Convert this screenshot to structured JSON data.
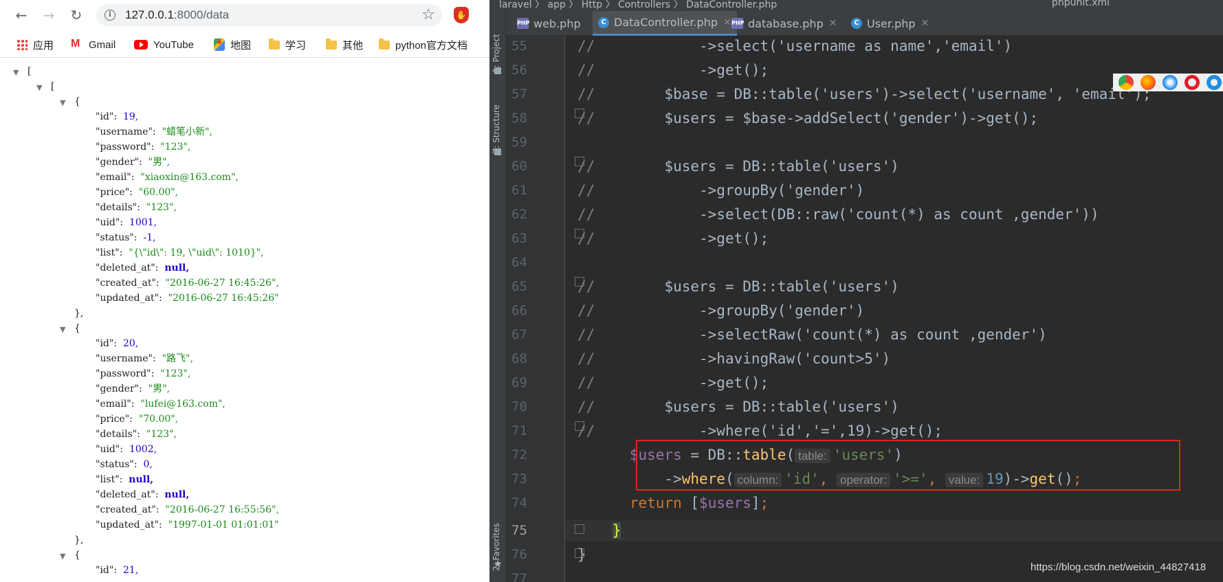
{
  "browser": {
    "url_host": "127.0.0.1",
    "url_rest": ":8000/data",
    "bookmarks": [
      "应用",
      "Gmail",
      "YouTube",
      "地图",
      "学习",
      "其他",
      "python官方文档"
    ]
  },
  "json_lines": [
    "[",
    "[",
    "{",
    "\"id\":",
    "19,",
    "\"username\":",
    "\"蜡笔小新\",",
    "\"password\":",
    "\"123\",",
    "\"gender\":",
    "\"男\",",
    "\"email\":",
    "\"xiaoxin@163.com\",",
    "\"price\":",
    "\"60.00\",",
    "\"details\":",
    "\"123\",",
    "\"uid\":",
    "1001,",
    "\"status\":",
    "-1,",
    "\"list\":",
    "\"{\\\"id\\\": 19, \\\"uid\\\": 1010}\",",
    "\"deleted_at\":",
    "null,",
    "\"created_at\":",
    "\"2016-06-27 16:45:26\",",
    "\"updated_at\":",
    "\"2016-06-27 16:45:26\"",
    "},",
    "{",
    "\"id\":",
    "20,",
    "\"username\":",
    "\"路飞\",",
    "\"password\":",
    "\"123\",",
    "\"gender\":",
    "\"男\",",
    "\"email\":",
    "\"lufei@163.com\",",
    "\"price\":",
    "\"70.00\",",
    "\"details\":",
    "\"123\",",
    "\"uid\":",
    "1002,",
    "\"status\":",
    "0,",
    "\"list\":",
    "null,",
    "\"deleted_at\":",
    "null,",
    "\"created_at\":",
    "\"2016-06-27 16:55:56\",",
    "\"updated_at\":",
    "\"1997-01-01 01:01:01\"",
    "},",
    "{",
    "\"id\":",
    "21,"
  ],
  "ide": {
    "breadcrumb": "laravel  〉 app  〉 Http  〉 Controllers  〉 DataController.php",
    "run_config": "phpunit.xml",
    "project_label": "1: Project",
    "structure_label": "Z: Structure",
    "favorites_label": "2: Favorites",
    "tabs": [
      "web.php",
      "DataController.php",
      "database.php",
      "User.php"
    ],
    "line_numbers": [
      "55",
      "56",
      "57",
      "58",
      "59",
      "60",
      "61",
      "62",
      "63",
      "64",
      "65",
      "66",
      "67",
      "68",
      "69",
      "70",
      "71",
      "72",
      "73",
      "74",
      "75",
      "76",
      "77"
    ],
    "code": {
      "l55": "->select('username as name','email')",
      "l56": "->get();",
      "l57a": "$base = DB::table('users')->select('username', 'email');",
      "l58": "$users = $base->addSelect('gender')->get();",
      "l60": "$users = DB::table('users')",
      "l61": "->groupBy('gender')",
      "l62": "->select(DB::raw('count(*) as count ,gender'))",
      "l63": "->get();",
      "l65": "$users = DB::table('users')",
      "l66": "->groupBy('gender')",
      "l67": "->selectRaw('count(*) as count ,gender')",
      "l68": "->havingRaw('count>5')",
      "l69": "->get();",
      "l70": "$users = DB::table('users')",
      "l71": "->where('id','=',19)->get();",
      "hint_table": "table:",
      "hint_column": "column:",
      "hint_operator": "operator:",
      "hint_value": "value:",
      "comment": "//"
    },
    "watermark": "https://blog.csdn.net/weixin_44827418"
  }
}
